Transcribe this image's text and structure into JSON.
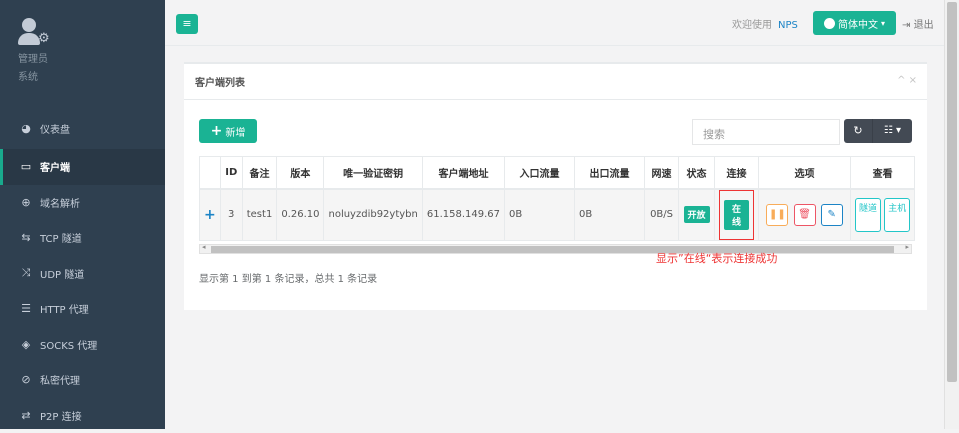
{
  "sidebar": {
    "role_name": "管理员",
    "role_sub": "系统",
    "items": [
      {
        "label": "仪表盘",
        "icon": "dashboard-icon"
      },
      {
        "label": "客户端",
        "icon": "monitor-icon"
      },
      {
        "label": "域名解析",
        "icon": "globe-icon"
      },
      {
        "label": "TCP 隧道",
        "icon": "exchange-icon"
      },
      {
        "label": "UDP 隧道",
        "icon": "shuffle-icon"
      },
      {
        "label": "HTTP 代理",
        "icon": "server-icon"
      },
      {
        "label": "SOCKS 代理",
        "icon": "layers-icon"
      },
      {
        "label": "私密代理",
        "icon": "eye-slash-icon"
      },
      {
        "label": "P2P 连接",
        "icon": "arrows-icon"
      }
    ]
  },
  "topbar": {
    "menu_icon": "≡",
    "welcome": "欢迎使用",
    "brand": "NPS",
    "language": "简体中文",
    "logout": "退出"
  },
  "panel": {
    "title": "客户端列表",
    "tools": "^ ×",
    "add_label": "新增",
    "search_placeholder": "搜索",
    "table": {
      "headers": [
        "",
        "ID",
        "备注",
        "版本",
        "唯一验证密钥",
        "客户端地址",
        "入口流量",
        "出口流量",
        "网速",
        "状态",
        "连接",
        "选项",
        "查看"
      ],
      "row": {
        "expand": "+",
        "id": "3",
        "remark": "test1",
        "version": "0.26.10",
        "key": "noluyzdib92ytybn",
        "address": "61.158.149.67",
        "in_flow": "0B",
        "out_flow": "0B",
        "speed": "0B/S",
        "status": "开放",
        "connection": "在线",
        "view1": "隧道",
        "view2": "主机"
      }
    },
    "annotation": "显示”在线“表示连接成功",
    "summary": "显示第 1 到第 1 条记录，总共 1 条记录"
  }
}
